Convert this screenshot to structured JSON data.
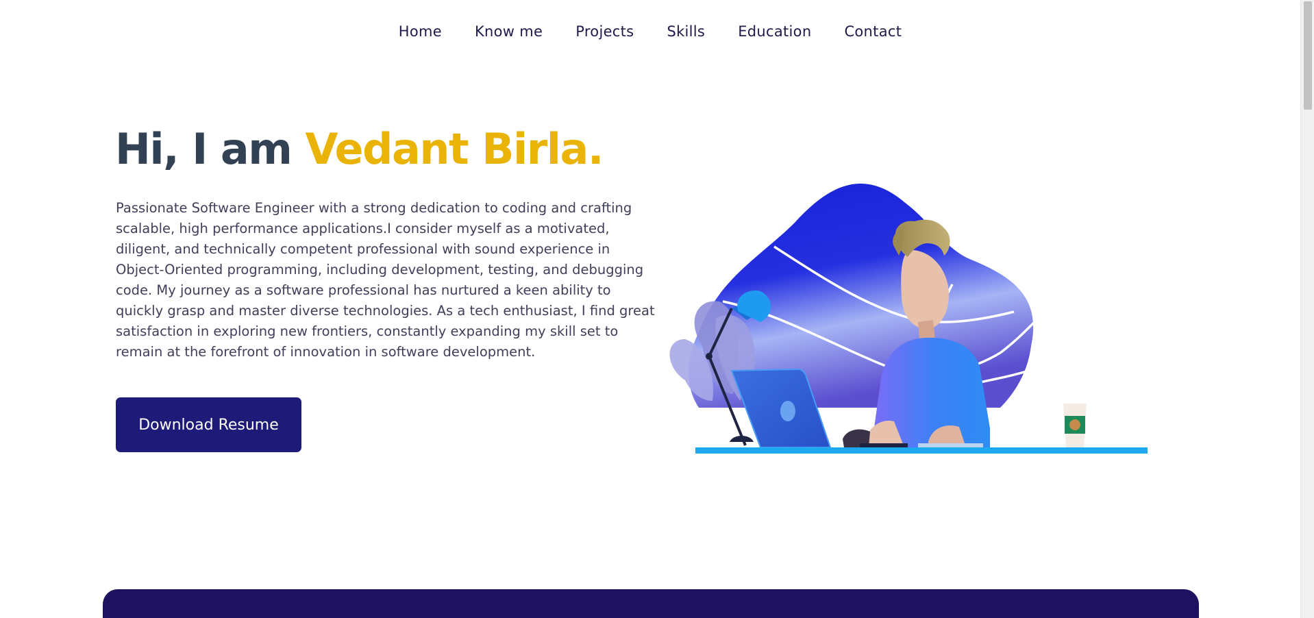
{
  "nav": {
    "items": [
      {
        "label": "Home"
      },
      {
        "label": "Know me"
      },
      {
        "label": "Projects"
      },
      {
        "label": "Skills"
      },
      {
        "label": "Education"
      },
      {
        "label": "Contact"
      }
    ]
  },
  "hero": {
    "greeting": "Hi, I am ",
    "name": "Vedant Birla.",
    "description": "Passionate Software Engineer with a strong dedication to coding and crafting scalable, high performance applications.I consider myself as a motivated, diligent, and technically competent professional with sound experience in Object-Oriented programming, including development, testing, and debugging code. My journey as a software professional has nurtured a keen ability to quickly grasp and master diverse technologies. As a tech enthusiast, I find great satisfaction in exploring new frontiers, constantly expanding my skill set to remain at the forefront of innovation in software development.",
    "resume_button": "Download Resume"
  },
  "colors": {
    "heading": "#334155",
    "accent": "#eab308",
    "button": "#1e1a78",
    "band": "#1e1160"
  },
  "icons": {
    "illustration": "developer-at-laptop-illustration"
  }
}
